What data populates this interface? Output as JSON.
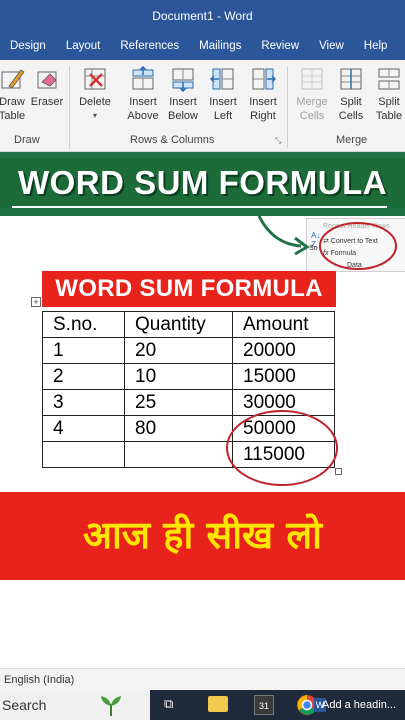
{
  "window": {
    "title": "Document1  -  Word"
  },
  "tabs": [
    "Design",
    "Layout",
    "References",
    "Mailings",
    "Review",
    "View",
    "Help"
  ],
  "ribbon": {
    "draw": {
      "draw_table": "Draw\nTable",
      "eraser": "Eraser",
      "group_label": "Draw"
    },
    "rows_cols": {
      "delete": "Delete",
      "insert_above": "Insert\nAbove",
      "insert_below": "Insert\nBelow",
      "insert_left": "Insert\nLeft",
      "insert_right": "Insert\nRight",
      "group_label": "Rows & Columns"
    },
    "merge": {
      "merge_cells": "Merge\nCells",
      "split_cells": "Split\nCells",
      "split_table": "Split\nTable",
      "group_label": "Merge"
    }
  },
  "banner": {
    "title": "WORD SUM FORMULA"
  },
  "popup": {
    "repeat_header": "Repeat Header Rows",
    "convert_to_text": "Convert to Text",
    "formula": "Formula",
    "group_label": "Data",
    "sort_label": "So"
  },
  "table": {
    "title": "WORD SUM FORMULA",
    "headers": [
      "S.no.",
      "Quantity",
      "Amount"
    ],
    "rows": [
      [
        "1",
        "20",
        "20000"
      ],
      [
        "2",
        "10",
        "15000"
      ],
      [
        "3",
        "25",
        "30000"
      ],
      [
        "4",
        "80",
        "50000"
      ],
      [
        "",
        "",
        "115000"
      ]
    ]
  },
  "hindi_banner": {
    "text": "आज ही सीख लो"
  },
  "statusbar": {
    "language": "English (India)"
  },
  "taskbar": {
    "search": "Search",
    "add_heading": "Add a headin..."
  },
  "colors": {
    "word_blue": "#2b579a",
    "green": "#217346",
    "red": "#e8231b",
    "yellow": "#ffe600"
  }
}
